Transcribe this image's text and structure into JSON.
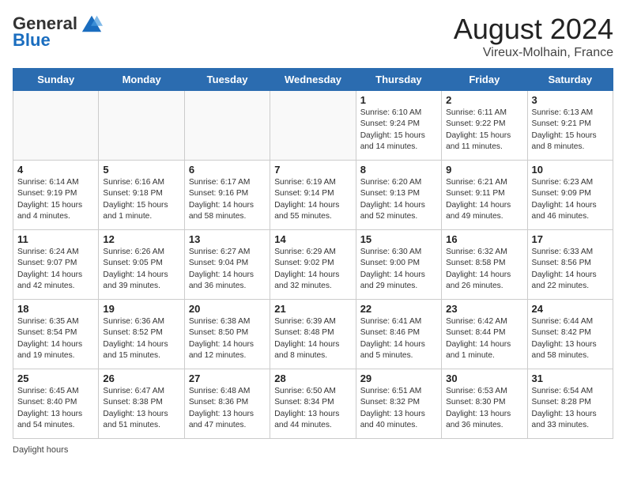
{
  "logo": {
    "general": "General",
    "blue": "Blue"
  },
  "title": {
    "month_year": "August 2024",
    "location": "Vireux-Molhain, France"
  },
  "headers": [
    "Sunday",
    "Monday",
    "Tuesday",
    "Wednesday",
    "Thursday",
    "Friday",
    "Saturday"
  ],
  "weeks": [
    [
      {
        "day": "",
        "text": ""
      },
      {
        "day": "",
        "text": ""
      },
      {
        "day": "",
        "text": ""
      },
      {
        "day": "",
        "text": ""
      },
      {
        "day": "1",
        "text": "Sunrise: 6:10 AM\nSunset: 9:24 PM\nDaylight: 15 hours and 14 minutes."
      },
      {
        "day": "2",
        "text": "Sunrise: 6:11 AM\nSunset: 9:22 PM\nDaylight: 15 hours and 11 minutes."
      },
      {
        "day": "3",
        "text": "Sunrise: 6:13 AM\nSunset: 9:21 PM\nDaylight: 15 hours and 8 minutes."
      }
    ],
    [
      {
        "day": "4",
        "text": "Sunrise: 6:14 AM\nSunset: 9:19 PM\nDaylight: 15 hours and 4 minutes."
      },
      {
        "day": "5",
        "text": "Sunrise: 6:16 AM\nSunset: 9:18 PM\nDaylight: 15 hours and 1 minute."
      },
      {
        "day": "6",
        "text": "Sunrise: 6:17 AM\nSunset: 9:16 PM\nDaylight: 14 hours and 58 minutes."
      },
      {
        "day": "7",
        "text": "Sunrise: 6:19 AM\nSunset: 9:14 PM\nDaylight: 14 hours and 55 minutes."
      },
      {
        "day": "8",
        "text": "Sunrise: 6:20 AM\nSunset: 9:13 PM\nDaylight: 14 hours and 52 minutes."
      },
      {
        "day": "9",
        "text": "Sunrise: 6:21 AM\nSunset: 9:11 PM\nDaylight: 14 hours and 49 minutes."
      },
      {
        "day": "10",
        "text": "Sunrise: 6:23 AM\nSunset: 9:09 PM\nDaylight: 14 hours and 46 minutes."
      }
    ],
    [
      {
        "day": "11",
        "text": "Sunrise: 6:24 AM\nSunset: 9:07 PM\nDaylight: 14 hours and 42 minutes."
      },
      {
        "day": "12",
        "text": "Sunrise: 6:26 AM\nSunset: 9:05 PM\nDaylight: 14 hours and 39 minutes."
      },
      {
        "day": "13",
        "text": "Sunrise: 6:27 AM\nSunset: 9:04 PM\nDaylight: 14 hours and 36 minutes."
      },
      {
        "day": "14",
        "text": "Sunrise: 6:29 AM\nSunset: 9:02 PM\nDaylight: 14 hours and 32 minutes."
      },
      {
        "day": "15",
        "text": "Sunrise: 6:30 AM\nSunset: 9:00 PM\nDaylight: 14 hours and 29 minutes."
      },
      {
        "day": "16",
        "text": "Sunrise: 6:32 AM\nSunset: 8:58 PM\nDaylight: 14 hours and 26 minutes."
      },
      {
        "day": "17",
        "text": "Sunrise: 6:33 AM\nSunset: 8:56 PM\nDaylight: 14 hours and 22 minutes."
      }
    ],
    [
      {
        "day": "18",
        "text": "Sunrise: 6:35 AM\nSunset: 8:54 PM\nDaylight: 14 hours and 19 minutes."
      },
      {
        "day": "19",
        "text": "Sunrise: 6:36 AM\nSunset: 8:52 PM\nDaylight: 14 hours and 15 minutes."
      },
      {
        "day": "20",
        "text": "Sunrise: 6:38 AM\nSunset: 8:50 PM\nDaylight: 14 hours and 12 minutes."
      },
      {
        "day": "21",
        "text": "Sunrise: 6:39 AM\nSunset: 8:48 PM\nDaylight: 14 hours and 8 minutes."
      },
      {
        "day": "22",
        "text": "Sunrise: 6:41 AM\nSunset: 8:46 PM\nDaylight: 14 hours and 5 minutes."
      },
      {
        "day": "23",
        "text": "Sunrise: 6:42 AM\nSunset: 8:44 PM\nDaylight: 14 hours and 1 minute."
      },
      {
        "day": "24",
        "text": "Sunrise: 6:44 AM\nSunset: 8:42 PM\nDaylight: 13 hours and 58 minutes."
      }
    ],
    [
      {
        "day": "25",
        "text": "Sunrise: 6:45 AM\nSunset: 8:40 PM\nDaylight: 13 hours and 54 minutes."
      },
      {
        "day": "26",
        "text": "Sunrise: 6:47 AM\nSunset: 8:38 PM\nDaylight: 13 hours and 51 minutes."
      },
      {
        "day": "27",
        "text": "Sunrise: 6:48 AM\nSunset: 8:36 PM\nDaylight: 13 hours and 47 minutes."
      },
      {
        "day": "28",
        "text": "Sunrise: 6:50 AM\nSunset: 8:34 PM\nDaylight: 13 hours and 44 minutes."
      },
      {
        "day": "29",
        "text": "Sunrise: 6:51 AM\nSunset: 8:32 PM\nDaylight: 13 hours and 40 minutes."
      },
      {
        "day": "30",
        "text": "Sunrise: 6:53 AM\nSunset: 8:30 PM\nDaylight: 13 hours and 36 minutes."
      },
      {
        "day": "31",
        "text": "Sunrise: 6:54 AM\nSunset: 8:28 PM\nDaylight: 13 hours and 33 minutes."
      }
    ]
  ],
  "footer": {
    "daylight_hours": "Daylight hours"
  }
}
